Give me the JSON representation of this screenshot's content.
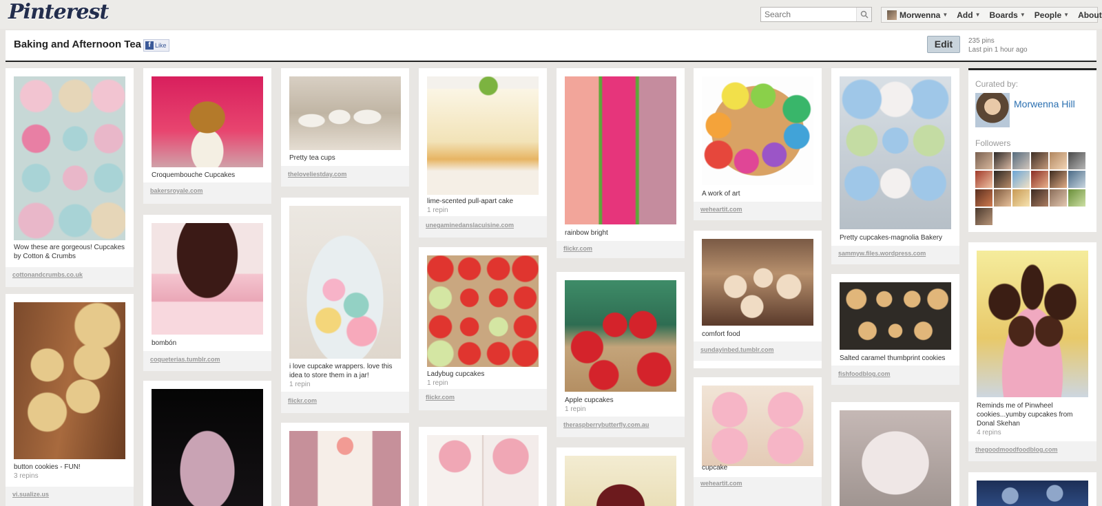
{
  "app": {
    "logo": "Pinterest"
  },
  "search": {
    "placeholder": "Search"
  },
  "nav": {
    "user": "Morwenna",
    "add": "Add",
    "boards": "Boards",
    "people": "People",
    "about": "About"
  },
  "board": {
    "title": "Baking and Afternoon Tea",
    "like_label": "Like",
    "edit_label": "Edit",
    "pin_count": "235 pins",
    "last_pin": "Last pin 1 hour ago"
  },
  "curated": {
    "label": "Curated by:",
    "name": "Morwenna Hill",
    "followers_label": "Followers"
  },
  "pins": [
    {
      "desc": "Wow these are gorgeous! Cupcakes by Cotton & Crumbs",
      "repins": "",
      "source": "cottonandcrumbs.co.uk"
    },
    {
      "desc": "button cookies - FUN!",
      "repins": "3 repins",
      "source": "vi.sualize.us"
    },
    {
      "desc": "Croquembouche Cupcakes",
      "repins": "",
      "source": "bakersroyale.com"
    },
    {
      "desc": "bombón",
      "repins": "",
      "source": "coqueterias.tumblr.com"
    },
    {
      "desc": "",
      "repins": "",
      "source": ""
    },
    {
      "desc": "Pretty tea cups",
      "repins": "",
      "source": "theloveliestday.com"
    },
    {
      "desc": "i love cupcake wrappers. love this idea to store them in a jar!",
      "repins": "1 repin",
      "source": "flickr.com"
    },
    {
      "desc": "",
      "repins": "",
      "source": ""
    },
    {
      "desc": "lime-scented pull-apart cake",
      "repins": "1 repin",
      "source": "unegaminedanslacuisine.com"
    },
    {
      "desc": "Ladybug cupcakes",
      "repins": "1 repin",
      "source": "flickr.com"
    },
    {
      "desc": "",
      "repins": "",
      "source": ""
    },
    {
      "desc": "rainbow bright",
      "repins": "",
      "source": "flickr.com"
    },
    {
      "desc": "Apple cupcakes",
      "repins": "1 repin",
      "source": "theraspberrybutterfly.com.au"
    },
    {
      "desc": "",
      "repins": "",
      "source": ""
    },
    {
      "desc": "A work of art",
      "repins": "",
      "source": "weheartit.com"
    },
    {
      "desc": "comfort food",
      "repins": "",
      "source": "sundayinbed.tumblr.com"
    },
    {
      "desc": "cupcake",
      "repins": "",
      "source": "weheartit.com"
    },
    {
      "desc": "Pretty cupcakes-magnolia Bakery",
      "repins": "",
      "source": "sammyw.files.wordpress.com"
    },
    {
      "desc": "Salted caramel thumbprint cookies",
      "repins": "",
      "source": "fishfoodblog.com"
    },
    {
      "desc": "",
      "repins": "",
      "source": ""
    },
    {
      "desc": "Reminds me of Pinwheel cookies...yumby cupcakes from Donal Skehan",
      "repins": "4 repins",
      "source": "thegoodmoodfoodblog.com"
    },
    {
      "desc": "",
      "repins": "",
      "source": ""
    }
  ],
  "colors": {
    "accent_link": "#2a6fb0",
    "logo": "#222d4d",
    "background": "#e8e6e3"
  }
}
